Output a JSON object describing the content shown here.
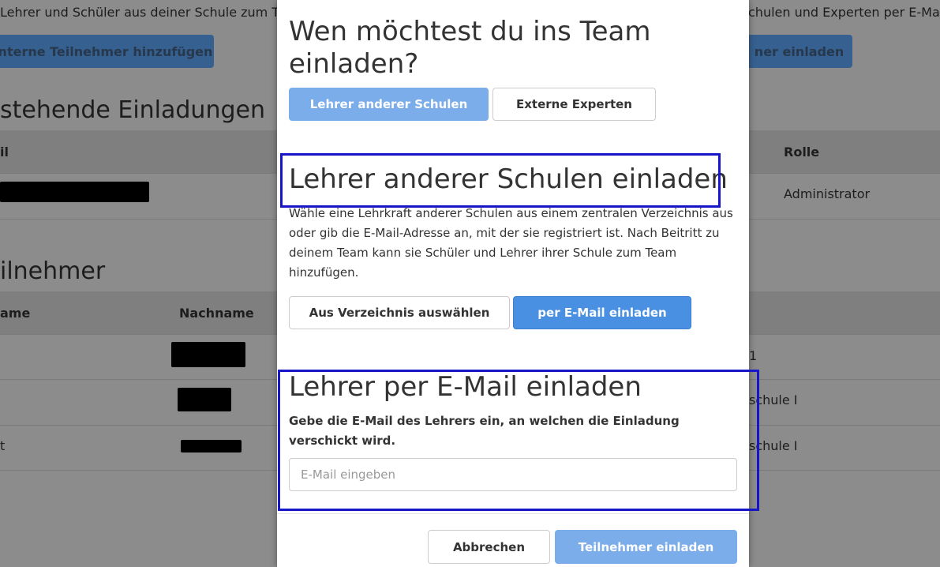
{
  "background": {
    "top_left_text": "Lehrer und Schüler aus deiner Schule zum Tea",
    "top_right_text": "chulen und Experten per E-Ma",
    "internal_button": "Interne Teilnehmer hinzufügen",
    "right_button": "ner einladen",
    "pending_heading": "stehende Einladungen",
    "pending_table": {
      "col_email": "il",
      "col_role": "Rolle",
      "row_role": "Administrator"
    },
    "participants_heading": "ilnehmer",
    "participants_table": {
      "col_firstname": "ame",
      "col_lastname": "Nachname",
      "rows": [
        {
          "first": "",
          "right": "1"
        },
        {
          "first": "",
          "right": "schule I"
        },
        {
          "first": "t",
          "right": "schule I"
        }
      ]
    }
  },
  "modal": {
    "title": "Wen möchtest du ins Team einladen?",
    "type_tabs": {
      "teachers": "Lehrer anderer Schulen",
      "experts": "Externe Experten"
    },
    "section1": {
      "title": "Lehrer anderer Schulen einladen",
      "description": "Wähle eine Lehrkraft anderer Schulen aus einem zentralen Verzeichnis aus oder gib die E-Mail-Adresse an, mit der sie registriert ist. Nach Beitritt zu deinem Team kann sie Schüler und Lehrer ihrer Schule zum Team hinzufügen.",
      "btn_directory": "Aus Verzeichnis auswählen",
      "btn_email": "per E-Mail einladen"
    },
    "section2": {
      "title": "Lehrer per E-Mail einladen",
      "label": "Gebe die E-Mail des Lehrers ein, an welchen die Einladung verschickt wird.",
      "email_placeholder": "E-Mail eingeben",
      "email_value": ""
    },
    "footer": {
      "cancel": "Abbrechen",
      "submit": "Teilnehmer einladen"
    }
  },
  "colors": {
    "primary": "#4a90e2",
    "primary_light": "#7aadea",
    "highlight_box": "#1616c8"
  }
}
